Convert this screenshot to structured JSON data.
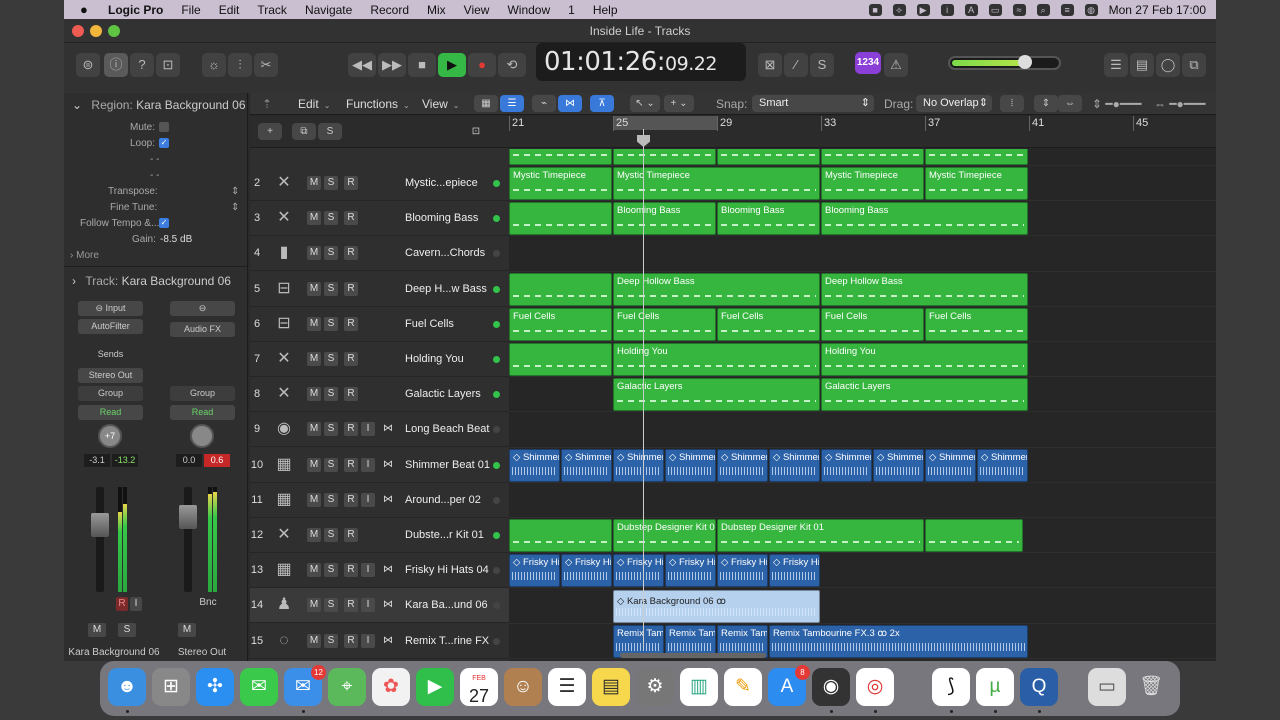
{
  "menubar": {
    "app": "Logic Pro",
    "items": [
      "File",
      "Edit",
      "Track",
      "Navigate",
      "Record",
      "Mix",
      "View",
      "Window",
      "1",
      "Help"
    ],
    "clock": "Mon 27 Feb  17:00"
  },
  "window": {
    "title": "Inside Life - Tracks",
    "lcd_main": "01:01:26:",
    "lcd_frames": "09.22",
    "tempo_badge": "1234"
  },
  "inspector": {
    "region_label": "Region:",
    "region_name": "Kara Background 06",
    "mute": "Mute:",
    "loop": "Loop:",
    "quantize": "- -",
    "qstrength": "- -",
    "transpose": "Transpose:",
    "fine_tune": "Fine Tune:",
    "follow_tempo": "Follow Tempo &...",
    "gain": "Gain:",
    "gain_value": "-8.5 dB",
    "more": "More",
    "track_label": "Track:",
    "track_name": "Kara Background 06",
    "strip1": {
      "input": "Input",
      "fx": "AutoFilter",
      "sends": "Sends",
      "output": "Stereo Out",
      "group": "Group",
      "auto": "Read",
      "knob": "+7",
      "val1": "-3.1",
      "val2": "-13.2",
      "r": "R",
      "i": "I",
      "m": "M",
      "s": "S",
      "name": "Kara Background 06"
    },
    "strip2": {
      "fx": "Audio FX",
      "group": "Group",
      "auto": "Read",
      "val1": "0.0",
      "val2": "0.6",
      "bnc": "Bnc",
      "m": "M",
      "name": "Stereo Out"
    }
  },
  "main_toolbar": {
    "edit": "Edit",
    "functions": "Functions",
    "view": "View",
    "snap_label": "Snap:",
    "snap_value": "Smart",
    "drag_label": "Drag:",
    "drag_value": "No Overlap",
    "s_button": "S"
  },
  "ruler": {
    "bars": [
      "21",
      "25",
      "29",
      "33",
      "37",
      "41",
      "45"
    ]
  },
  "tracks": [
    {
      "num": "2",
      "name": "Mystic...epiece",
      "icon": "✕",
      "type": "midi",
      "dot": "#33c24a",
      "input": false
    },
    {
      "num": "3",
      "name": "Blooming Bass",
      "icon": "✕",
      "type": "midi",
      "dot": "#33c24a",
      "input": false
    },
    {
      "num": "4",
      "name": "Cavern...Chords",
      "icon": "▮",
      "type": "midi",
      "dot": "#444",
      "input": false
    },
    {
      "num": "5",
      "name": "Deep H...w Bass",
      "icon": "⊟",
      "type": "midi",
      "dot": "#33c24a",
      "input": false
    },
    {
      "num": "6",
      "name": "Fuel Cells",
      "icon": "⊟",
      "type": "midi",
      "dot": "#33c24a",
      "input": false
    },
    {
      "num": "7",
      "name": "Holding You",
      "icon": "✕",
      "type": "midi",
      "dot": "#33c24a",
      "input": false
    },
    {
      "num": "8",
      "name": "Galactic Layers",
      "icon": "✕",
      "type": "midi",
      "dot": "#33c24a",
      "input": false
    },
    {
      "num": "9",
      "name": "Long Beach Beat",
      "icon": "◉",
      "type": "audio",
      "dot": "#444",
      "input": true
    },
    {
      "num": "10",
      "name": "Shimmer Beat 01",
      "icon": "▦",
      "type": "audio",
      "dot": "#33c24a",
      "input": true
    },
    {
      "num": "11",
      "name": "Around...per 02",
      "icon": "▦",
      "type": "audio",
      "dot": "#444",
      "input": true
    },
    {
      "num": "12",
      "name": "Dubste...r Kit 01",
      "icon": "✕",
      "type": "midi",
      "dot": "#33c24a",
      "input": false
    },
    {
      "num": "13",
      "name": "Frisky Hi Hats 04",
      "icon": "▦",
      "type": "audio",
      "dot": "#444",
      "input": true
    },
    {
      "num": "14",
      "name": "Kara Ba...und 06",
      "icon": "♟",
      "type": "audio",
      "dot": "#444",
      "input": true
    },
    {
      "num": "15",
      "name": "Remix T...rine FX",
      "icon": "◌",
      "type": "audio",
      "dot": "#444",
      "input": true
    }
  ],
  "regions": {
    "top": [
      [
        0,
        4,
        "",
        0
      ],
      [
        4,
        4,
        "",
        0
      ],
      [
        8,
        4,
        "",
        0
      ],
      [
        12,
        4,
        "",
        0
      ],
      [
        16,
        4,
        "",
        0
      ]
    ],
    "r2": [
      [
        0,
        4,
        "Mystic Timepiece",
        0
      ],
      [
        4,
        8,
        "Mystic Timepiece",
        0
      ],
      [
        12,
        4,
        "Mystic Timepiece",
        0
      ],
      [
        16,
        4,
        "Mystic Timepiece",
        0
      ]
    ],
    "r3": [
      [
        0,
        4,
        "",
        0
      ],
      [
        4,
        4,
        "Blooming Bass",
        0
      ],
      [
        8,
        4,
        "Blooming Bass",
        0
      ],
      [
        12,
        8,
        "Blooming Bass",
        0
      ]
    ],
    "r5": [
      [
        0,
        4,
        "",
        0
      ],
      [
        4,
        8,
        "Deep Hollow Bass",
        0
      ],
      [
        12,
        8,
        "Deep Hollow Bass",
        0
      ]
    ],
    "r6": [
      [
        0,
        4,
        "Fuel Cells",
        0
      ],
      [
        4,
        4,
        "Fuel Cells",
        0
      ],
      [
        8,
        4,
        "Fuel Cells",
        0
      ],
      [
        12,
        4,
        "Fuel Cells",
        0
      ],
      [
        16,
        4,
        "Fuel Cells",
        0
      ]
    ],
    "r7": [
      [
        0,
        4,
        "",
        0
      ],
      [
        4,
        8,
        "Holding You",
        0
      ],
      [
        12,
        8,
        "Holding You",
        0
      ]
    ],
    "r8": [
      [
        4,
        8,
        "Galactic Layers",
        0
      ],
      [
        12,
        8,
        "Galactic Layers",
        0
      ]
    ],
    "r10": [
      [
        0,
        2,
        "◇ Shimmer",
        1
      ],
      [
        2,
        2,
        "◇ Shimmer",
        1
      ],
      [
        4,
        2,
        "◇ Shimmer",
        1
      ],
      [
        6,
        2,
        "◇ Shimmer",
        1
      ],
      [
        8,
        2,
        "◇ Shimmer",
        1
      ],
      [
        10,
        2,
        "◇ Shimmer",
        1
      ],
      [
        12,
        2,
        "◇ Shimmer",
        1
      ],
      [
        14,
        2,
        "◇ Shimmer",
        1
      ],
      [
        16,
        2,
        "◇ Shimmer",
        1
      ],
      [
        18,
        2,
        "◇ Shimmer",
        1
      ]
    ],
    "r12": [
      [
        0,
        4,
        "",
        0
      ],
      [
        4,
        4,
        "Dubstep Designer Kit 01",
        0
      ],
      [
        8,
        8,
        "Dubstep Designer Kit 01",
        0
      ],
      [
        16,
        3.8,
        "",
        0
      ]
    ],
    "r13": [
      [
        0,
        2,
        "◇ Frisky Hi",
        1
      ],
      [
        2,
        2,
        "◇ Frisky Hi",
        1
      ],
      [
        4,
        2,
        "◇ Frisky Hi",
        1
      ],
      [
        6,
        2,
        "◇ Frisky Hi",
        1
      ],
      [
        8,
        2,
        "◇ Frisky Hi",
        1
      ],
      [
        10,
        2,
        "◇ Frisky Hi",
        1
      ]
    ],
    "r14": [
      [
        4,
        8,
        "◇ Kara Background 06  ꝏ",
        2
      ]
    ],
    "r15": [
      [
        4,
        2,
        "Remix Tam",
        1
      ],
      [
        6,
        2,
        "Remix Tam",
        1
      ],
      [
        8,
        2,
        "Remix Tam",
        1
      ],
      [
        10,
        10,
        "Remix Tambourine FX.3  ꝏ  2x",
        1
      ]
    ]
  },
  "dock": {
    "mail_badge": "12",
    "appstore_badge": "8",
    "cal_month": "FEB",
    "cal_day": "27"
  }
}
